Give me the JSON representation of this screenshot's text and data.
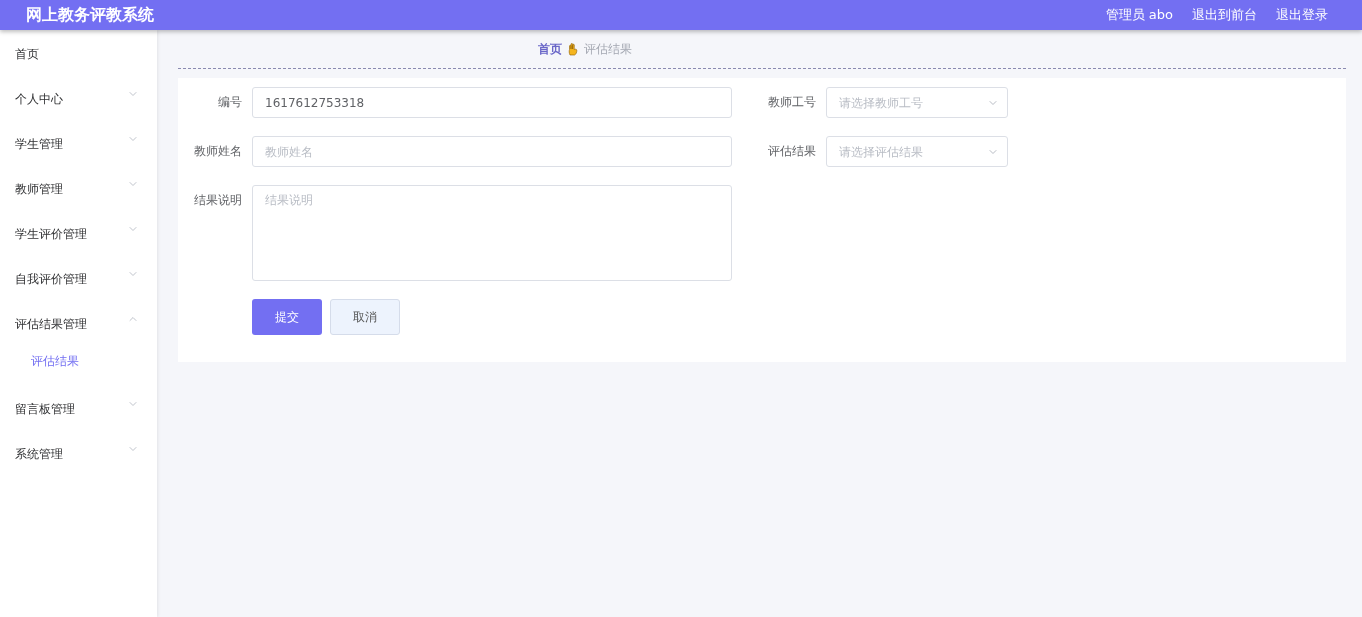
{
  "header": {
    "title": "网上教务评教系统",
    "user": "管理员 abo",
    "links": [
      "退出到前台",
      "退出登录"
    ]
  },
  "sidebar": {
    "items": [
      {
        "label": "首页",
        "kind": "link"
      },
      {
        "label": "个人中心",
        "kind": "group",
        "expanded": false
      },
      {
        "label": "学生管理",
        "kind": "group",
        "expanded": false
      },
      {
        "label": "教师管理",
        "kind": "group",
        "expanded": false
      },
      {
        "label": "学生评价管理",
        "kind": "group",
        "expanded": false
      },
      {
        "label": "自我评价管理",
        "kind": "group",
        "expanded": false
      },
      {
        "label": "评估结果管理",
        "kind": "group",
        "expanded": true,
        "children": [
          {
            "label": "评估结果",
            "selected": true
          }
        ]
      },
      {
        "label": "留言板管理",
        "kind": "group",
        "expanded": false
      },
      {
        "label": "系统管理",
        "kind": "group",
        "expanded": false
      }
    ]
  },
  "breadcrumb": {
    "items": [
      "首页",
      "评估结果"
    ]
  },
  "form": {
    "rows": [
      [
        {
          "label": "编号",
          "kind": "input",
          "value": "1617612753318"
        },
        {
          "label": "教师工号",
          "kind": "select",
          "placeholder": "请选择教师工号"
        }
      ],
      [
        {
          "label": "教师姓名",
          "kind": "input",
          "placeholder": "教师姓名"
        },
        {
          "label": "评估结果",
          "kind": "select",
          "placeholder": "请选择评估结果"
        }
      ],
      [
        {
          "label": "结果说明",
          "kind": "textarea",
          "placeholder": "结果说明"
        }
      ]
    ],
    "buttons": [
      {
        "label": "提交",
        "kind": "primary"
      },
      {
        "label": "取消",
        "kind": "secondary"
      }
    ]
  }
}
